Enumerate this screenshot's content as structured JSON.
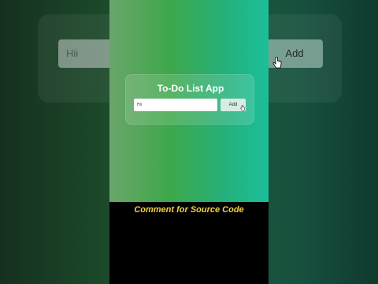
{
  "background": {
    "input_value": "Hii",
    "add_label": "Add"
  },
  "app": {
    "title": "To-Do List App",
    "input_value": "Hii",
    "add_label": "Add"
  },
  "caption": "Comment for Source Code",
  "colors": {
    "caption": "#f2d442",
    "gradient_start": "#3ea84a",
    "gradient_end": "#1bbf9a"
  },
  "icons": [
    "hand-pointer-cursor-icon"
  ]
}
